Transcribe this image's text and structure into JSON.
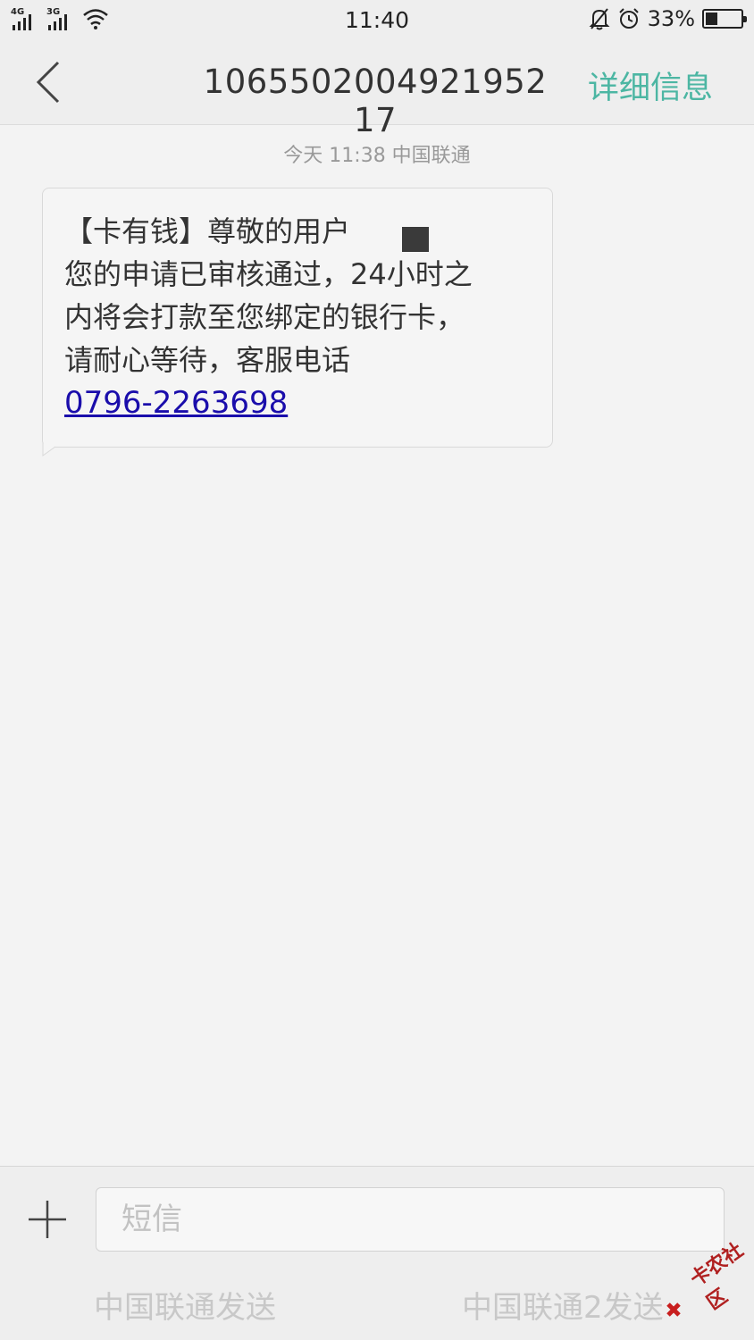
{
  "status_bar": {
    "network1": "4G",
    "network2": "3G",
    "time": "11:40",
    "battery_percent": "33%",
    "battery_level": 0.33
  },
  "header": {
    "title": "1065502004921952 17",
    "details_label": "详细信息"
  },
  "conversation": {
    "timestamp": "今天  11:38  中国联通",
    "message": {
      "text": "【卡有钱】尊敬的用户\n您的申请已审核通过，24小时之内将会打款至您绑定的银行卡，请耐心等待，客服电话",
      "phone": "0796-2263698"
    }
  },
  "compose": {
    "placeholder": "短信",
    "send1_label": "中国联通发送",
    "send2_label": "中国联通2发送"
  },
  "watermark": {
    "text": "卡农社区"
  },
  "colors": {
    "accent": "#4cb6a3",
    "link": "#1a0dab",
    "background": "#f3f3f3"
  }
}
